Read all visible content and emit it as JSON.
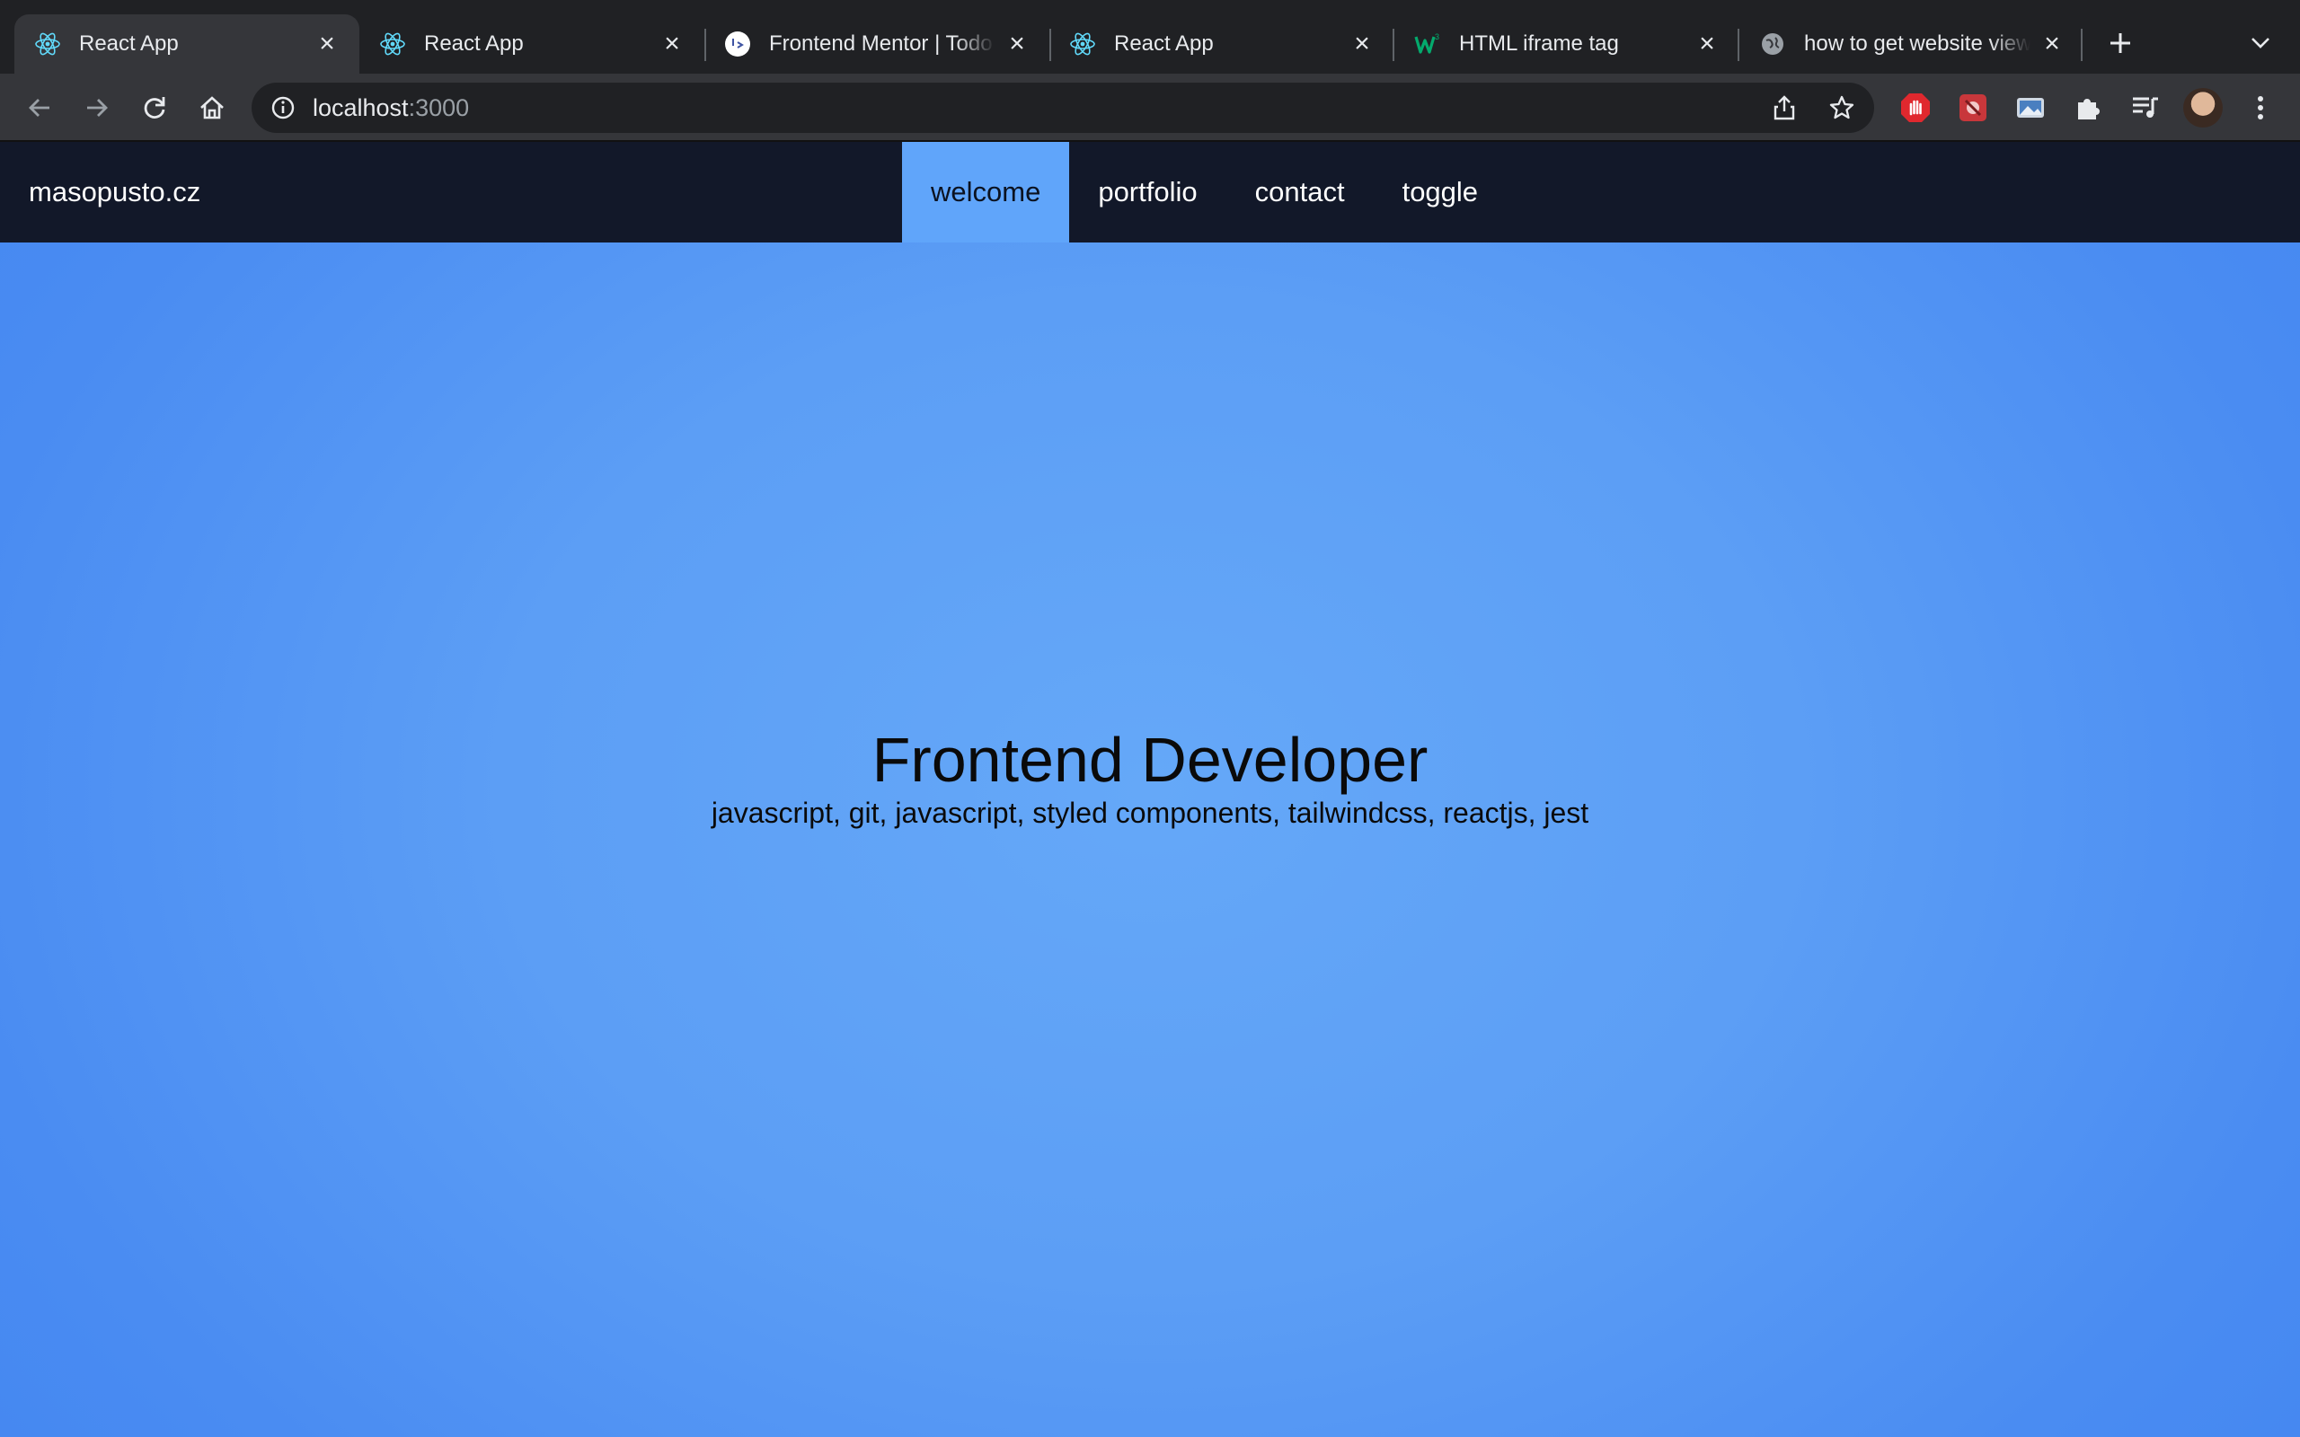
{
  "browser": {
    "tabs": [
      {
        "title": "React App",
        "icon": "react-icon",
        "active": true
      },
      {
        "title": "React App",
        "icon": "react-icon",
        "active": false
      },
      {
        "title": "Frontend Mentor | Todo",
        "icon": "frontend-mentor-icon",
        "active": false
      },
      {
        "title": "React App",
        "icon": "react-icon",
        "active": false
      },
      {
        "title": "HTML iframe tag",
        "icon": "w3schools-icon",
        "active": false
      },
      {
        "title": "how to get website view",
        "icon": "globe-icon",
        "active": false
      }
    ],
    "address": {
      "host": "localhost",
      "port": ":3000"
    },
    "colors": {
      "tabstrip": "#202124",
      "toolbar": "#35363a",
      "react": "#61dafb"
    }
  },
  "site": {
    "brand": "masopusto.cz",
    "nav": [
      {
        "label": "welcome",
        "active": true
      },
      {
        "label": "portfolio",
        "active": false
      },
      {
        "label": "contact",
        "active": false
      },
      {
        "label": "toggle",
        "active": false
      }
    ],
    "hero": {
      "title": "Frontend Developer",
      "skills": "javascript, git, javascript, styled components, tailwindcss, reactjs, jest"
    },
    "colors": {
      "nav_bg": "#121829",
      "active_tab": "#60a5fa",
      "page_bg": "#5c9ef5"
    }
  }
}
